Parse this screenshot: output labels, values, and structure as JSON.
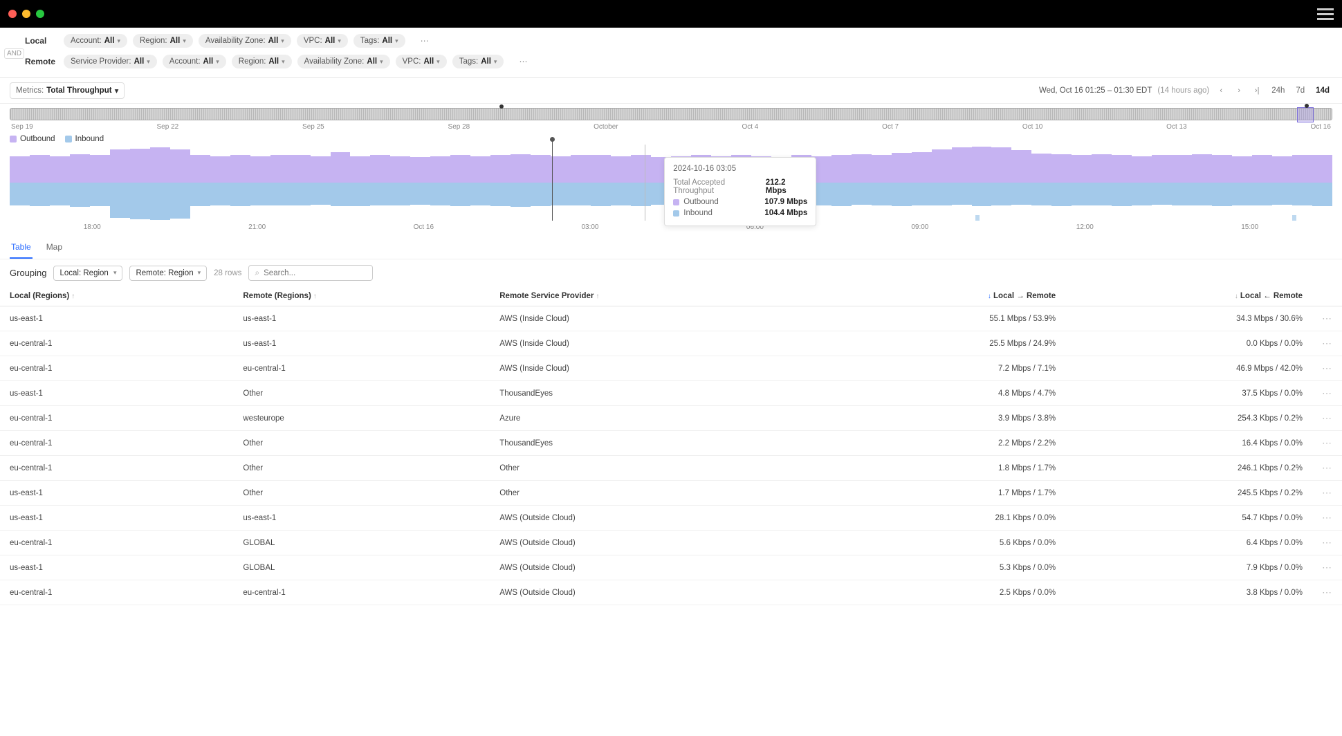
{
  "colors": {
    "outbound": "#c6b3f2",
    "inbound": "#a3c9ea",
    "accent": "#2b6cff"
  },
  "filters": {
    "and_label": "AND",
    "local": {
      "label": "Local",
      "chips": [
        {
          "label": "Account:",
          "value": "All"
        },
        {
          "label": "Region:",
          "value": "All"
        },
        {
          "label": "Availability Zone:",
          "value": "All"
        },
        {
          "label": "VPC:",
          "value": "All"
        },
        {
          "label": "Tags:",
          "value": "All"
        }
      ]
    },
    "remote": {
      "label": "Remote",
      "chips": [
        {
          "label": "Service Provider:",
          "value": "All"
        },
        {
          "label": "Account:",
          "value": "All"
        },
        {
          "label": "Region:",
          "value": "All"
        },
        {
          "label": "Availability Zone:",
          "value": "All"
        },
        {
          "label": "VPC:",
          "value": "All"
        },
        {
          "label": "Tags:",
          "value": "All"
        }
      ]
    }
  },
  "metrics": {
    "label": "Metrics:",
    "value": "Total Throughput"
  },
  "time": {
    "range_text": "Wed, Oct 16 01:25 – 01:30 EDT",
    "ago_text": "(14 hours ago)",
    "ranges": {
      "r24h": "24h",
      "r7d": "7d",
      "r14d": "14d"
    },
    "active_range": "14d"
  },
  "overview_ticks": [
    "Sep 19",
    "Sep 22",
    "Sep 25",
    "Sep 28",
    "October",
    "Oct 4",
    "Oct 7",
    "Oct 10",
    "Oct 13",
    "Oct 16"
  ],
  "legend": {
    "outbound": "Outbound",
    "inbound": "Inbound"
  },
  "chart_data": {
    "type": "area",
    "title": "Total Accepted Throughput",
    "ylabel": "Mbps",
    "x_ticks": [
      "18:00",
      "21:00",
      "Oct 16",
      "03:00",
      "06:00",
      "09:00",
      "12:00",
      "15:00"
    ],
    "cursor_time": "2024-10-16 03:05",
    "series": [
      {
        "name": "Outbound",
        "color": "#c6b3f2",
        "values": [
          70,
          72,
          70,
          74,
          72,
          88,
          90,
          92,
          88,
          72,
          70,
          72,
          70,
          72,
          72,
          70,
          80,
          70,
          72,
          70,
          68,
          70,
          72,
          70,
          72,
          74,
          72,
          70,
          72,
          72,
          70,
          72,
          68,
          70,
          72,
          70,
          72,
          70,
          68,
          72,
          70,
          72,
          74,
          72,
          78,
          80,
          88,
          92,
          94,
          92,
          86,
          76,
          74,
          72,
          74,
          72,
          70,
          72,
          72,
          74,
          72,
          70,
          72,
          70,
          72,
          72
        ]
      },
      {
        "name": "Inbound",
        "color": "#a3c9ea",
        "values": [
          60,
          62,
          60,
          64,
          62,
          92,
          96,
          98,
          94,
          62,
          60,
          62,
          60,
          60,
          60,
          58,
          62,
          62,
          60,
          60,
          58,
          60,
          62,
          60,
          62,
          64,
          62,
          60,
          60,
          62,
          60,
          62,
          58,
          60,
          62,
          60,
          62,
          60,
          58,
          62,
          60,
          62,
          58,
          60,
          62,
          60,
          60,
          58,
          62,
          60,
          58,
          60,
          62,
          60,
          60,
          62,
          60,
          58,
          60,
          60,
          62,
          60,
          60,
          58,
          60,
          62
        ]
      }
    ],
    "tooltip": {
      "time": "2024-10-16 03:05",
      "total_label": "Total Accepted Throughput",
      "total_value": "212.2 Mbps",
      "rows": [
        {
          "label": "Outbound",
          "value": "107.9 Mbps",
          "color": "#c6b3f2"
        },
        {
          "label": "Inbound",
          "value": "104.4 Mbps",
          "color": "#a3c9ea"
        }
      ]
    }
  },
  "tabs": {
    "table": "Table",
    "map": "Map",
    "active": "table"
  },
  "grouping": {
    "label": "Grouping",
    "local": "Local: Region",
    "remote": "Remote: Region",
    "rowcount": "28 rows",
    "search_placeholder": "Search..."
  },
  "table": {
    "headers": {
      "local": "Local (Regions)",
      "remote": "Remote (Regions)",
      "provider": "Remote Service Provider",
      "lr": "Local → Remote",
      "rl": "Local ← Remote"
    },
    "rows": [
      {
        "local": "us-east-1",
        "remote": "us-east-1",
        "provider": "AWS (Inside Cloud)",
        "lr": "55.1 Mbps / 53.9%",
        "rl": "34.3 Mbps / 30.6%"
      },
      {
        "local": "eu-central-1",
        "remote": "us-east-1",
        "provider": "AWS (Inside Cloud)",
        "lr": "25.5 Mbps / 24.9%",
        "rl": "0.0 Kbps / 0.0%"
      },
      {
        "local": "eu-central-1",
        "remote": "eu-central-1",
        "provider": "AWS (Inside Cloud)",
        "lr": "7.2 Mbps / 7.1%",
        "rl": "46.9 Mbps / 42.0%"
      },
      {
        "local": "us-east-1",
        "remote": "Other",
        "provider": "ThousandEyes",
        "lr": "4.8 Mbps / 4.7%",
        "rl": "37.5 Kbps / 0.0%"
      },
      {
        "local": "eu-central-1",
        "remote": "westeurope",
        "provider": "Azure",
        "lr": "3.9 Mbps / 3.8%",
        "rl": "254.3 Kbps / 0.2%"
      },
      {
        "local": "eu-central-1",
        "remote": "Other",
        "provider": "ThousandEyes",
        "lr": "2.2 Mbps / 2.2%",
        "rl": "16.4 Kbps / 0.0%"
      },
      {
        "local": "eu-central-1",
        "remote": "Other",
        "provider": "Other",
        "lr": "1.8 Mbps / 1.7%",
        "rl": "246.1 Kbps / 0.2%"
      },
      {
        "local": "us-east-1",
        "remote": "Other",
        "provider": "Other",
        "lr": "1.7 Mbps / 1.7%",
        "rl": "245.5 Kbps / 0.2%"
      },
      {
        "local": "us-east-1",
        "remote": "us-east-1",
        "provider": "AWS (Outside Cloud)",
        "lr": "28.1 Kbps / 0.0%",
        "rl": "54.7 Kbps / 0.0%"
      },
      {
        "local": "eu-central-1",
        "remote": "GLOBAL",
        "provider": "AWS (Outside Cloud)",
        "lr": "5.6 Kbps / 0.0%",
        "rl": "6.4 Kbps / 0.0%"
      },
      {
        "local": "us-east-1",
        "remote": "GLOBAL",
        "provider": "AWS (Outside Cloud)",
        "lr": "5.3 Kbps / 0.0%",
        "rl": "7.9 Kbps / 0.0%"
      },
      {
        "local": "eu-central-1",
        "remote": "eu-central-1",
        "provider": "AWS (Outside Cloud)",
        "lr": "2.5 Kbps / 0.0%",
        "rl": "3.8 Kbps / 0.0%"
      }
    ]
  }
}
